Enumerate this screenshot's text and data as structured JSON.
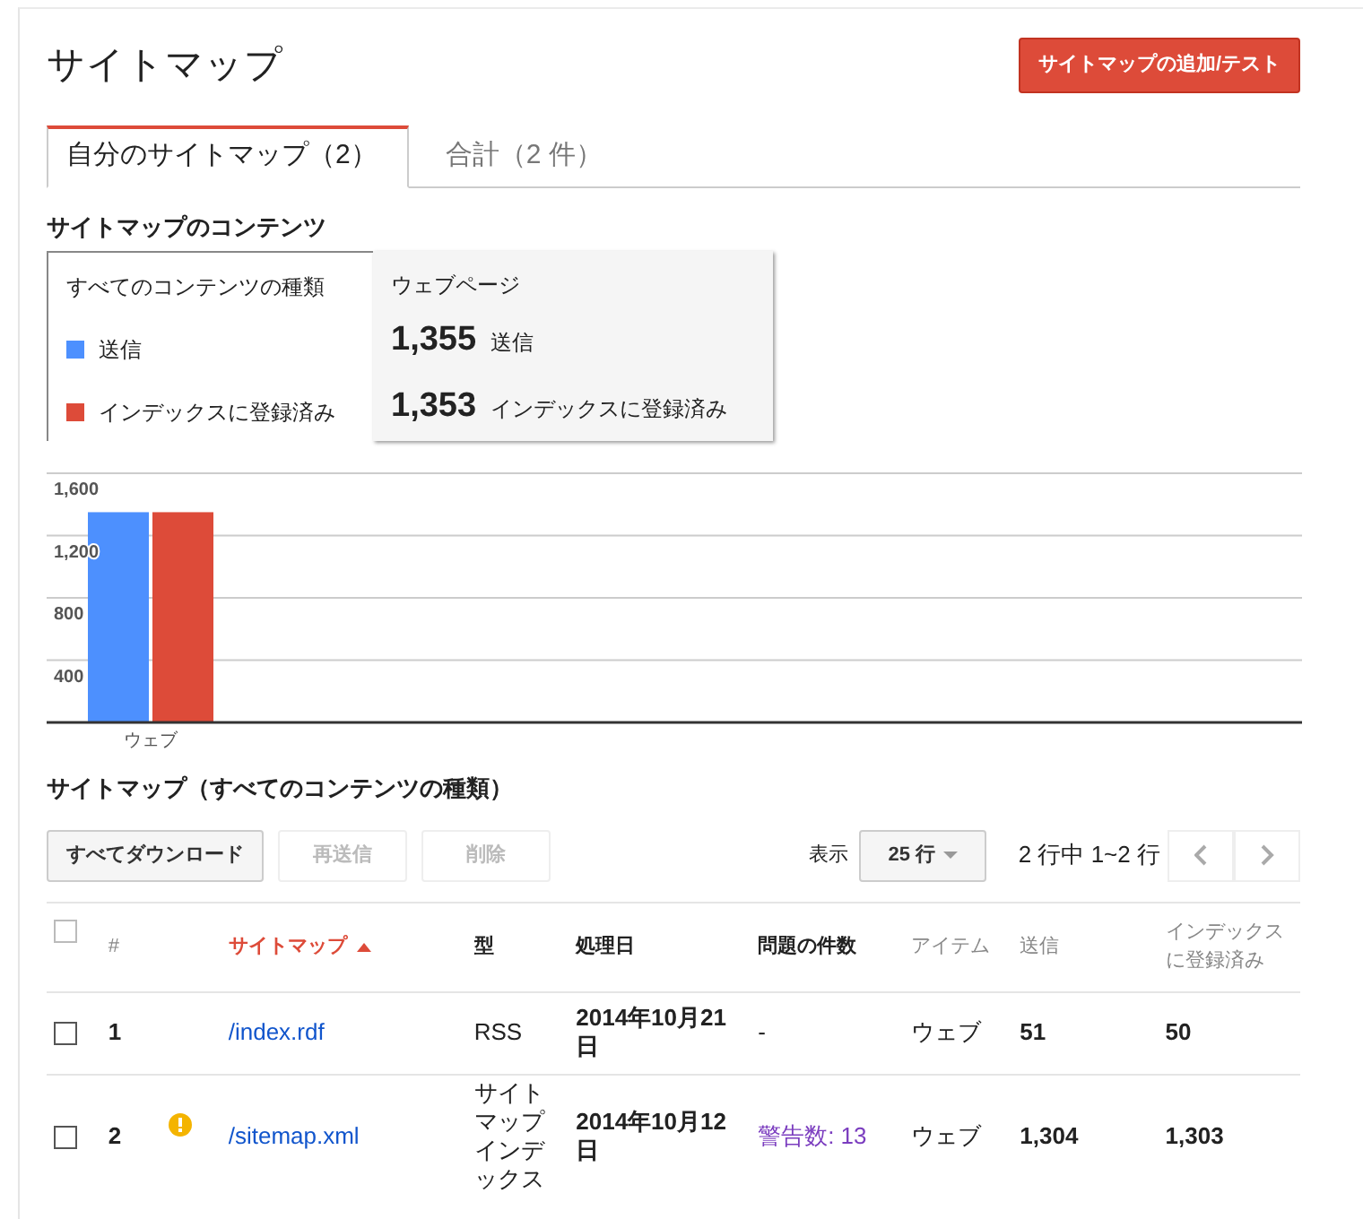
{
  "header": {
    "title": "サイトマップ",
    "add_button": "サイトマップの追加/テスト"
  },
  "tabs": [
    {
      "label": "自分のサイトマップ（2）",
      "selected": true
    },
    {
      "label": "合計（2 件）",
      "selected": false
    }
  ],
  "contents": {
    "heading": "サイトマップのコンテンツ",
    "filter": "すべてのコンテンツの種類",
    "detail": {
      "title": "ウェブページ",
      "rows": [
        {
          "value": "1,355",
          "label": "送信"
        },
        {
          "value": "1,353",
          "label": "インデックスに登録済み"
        }
      ]
    },
    "chart_data": {
      "type": "bar",
      "categories": [
        "ウェブ"
      ],
      "series": [
        {
          "name": "送信",
          "color": "#4d90fe",
          "values": [
            1350
          ]
        },
        {
          "name": "インデックスに登録済み",
          "color": "#dd4b39",
          "values": [
            1350
          ]
        }
      ],
      "ylim": [
        0,
        1600
      ],
      "grid": true,
      "yticks": [
        {
          "value": 400,
          "label": "400"
        },
        {
          "value": 800,
          "label": "800"
        },
        {
          "value": 1200,
          "label": "1,200"
        },
        {
          "value": 1600,
          "label": "1,600"
        }
      ]
    }
  },
  "list": {
    "heading": "サイトマップ（すべてのコンテンツの種類）",
    "buttons": [
      {
        "label": "すべてダウンロード",
        "disabled": false
      },
      {
        "label": "再送信",
        "disabled": true
      },
      {
        "label": "削除",
        "disabled": true
      }
    ],
    "show_label": "表示",
    "page_size": "25 行",
    "range": "2 行中 1~2 行",
    "columns": [
      {
        "label": "#",
        "muted": true,
        "sorted": false
      },
      {
        "label": "サイトマップ",
        "muted": false,
        "sorted": true
      },
      {
        "label": "型",
        "muted": false,
        "sorted": false
      },
      {
        "label": "処理日",
        "muted": false,
        "sorted": false
      },
      {
        "label": "問題の件数",
        "muted": false,
        "sorted": false
      },
      {
        "label": "アイテム",
        "muted": true,
        "sorted": false
      },
      {
        "label": "送信",
        "muted": true,
        "sorted": false
      },
      {
        "label": "インデックスに登録済み",
        "muted": true,
        "sorted": false
      }
    ],
    "header_checked": false,
    "rows": [
      {
        "checked": false,
        "number": "1",
        "warning": false,
        "sitemap": "/index.rdf",
        "type": "RSS",
        "date": "2014年10月21日",
        "issues": "-",
        "items": "ウェブ",
        "submitted": "51",
        "indexed": "50"
      },
      {
        "checked": false,
        "number": "2",
        "warning": true,
        "sitemap": "/sitemap.xml",
        "type": "サイトマップインデックス",
        "date": "2014年10月12日",
        "issues": "警告数: 13",
        "items": "ウェブ",
        "submitted": "1,304",
        "indexed": "1,303"
      }
    ]
  }
}
